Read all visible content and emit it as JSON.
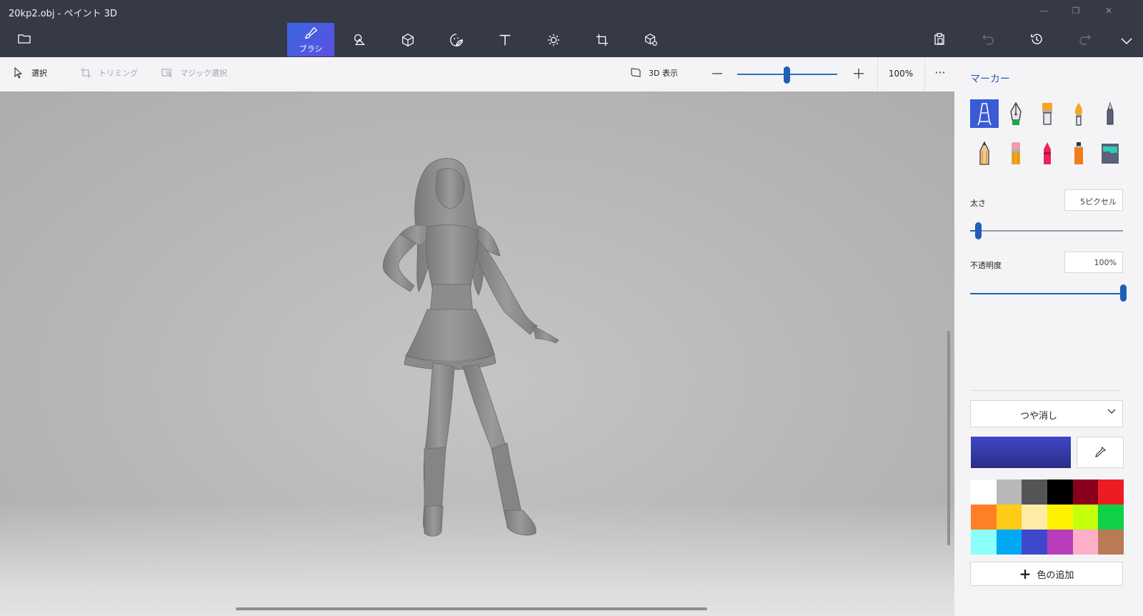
{
  "window": {
    "title": "20kp2.obj - ペイント 3D",
    "controls": [
      "minimize-icon",
      "restore-icon",
      "close-icon"
    ]
  },
  "menubar": {
    "tools": [
      {
        "id": "brushes",
        "label": "ブラシ",
        "icon": "brush-icon",
        "active": true
      },
      {
        "id": "2d-shapes",
        "label": "",
        "icon": "2d-shapes-icon"
      },
      {
        "id": "3d-shapes",
        "label": "",
        "icon": "3d-cube-icon"
      },
      {
        "id": "stickers",
        "label": "",
        "icon": "sticker-icon"
      },
      {
        "id": "text",
        "label": "",
        "icon": "text-icon"
      },
      {
        "id": "effects",
        "label": "",
        "icon": "effects-sun-icon"
      },
      {
        "id": "canvas",
        "label": "",
        "icon": "canvas-crop-icon"
      },
      {
        "id": "3d-library",
        "label": "",
        "icon": "3d-library-icon"
      }
    ],
    "right_icons": [
      "paste-icon",
      "undo-icon",
      "history-icon",
      "redo-icon",
      "chevron-down-icon"
    ]
  },
  "toolbar": {
    "select_label": "選択",
    "crop_label": "トリミング",
    "magic_select_label": "マジック選択",
    "view3d_label": "3D 表示",
    "zoom_value": "100%",
    "zoom_level": 0.5,
    "more_label": "···"
  },
  "panel": {
    "title": "マーカー",
    "brushes": [
      {
        "name": "marker",
        "selected": true
      },
      {
        "name": "calligraphy-pen"
      },
      {
        "name": "oil-brush"
      },
      {
        "name": "watercolor"
      },
      {
        "name": "pixel-pen"
      },
      {
        "name": "pencil"
      },
      {
        "name": "eraser"
      },
      {
        "name": "crayon"
      },
      {
        "name": "spray-can"
      },
      {
        "name": "fill"
      }
    ],
    "thickness_label": "太さ",
    "thickness_value": "5ピクセル",
    "thickness_level": 0.05,
    "opacity_label": "不透明度",
    "opacity_value": "100%",
    "opacity_level": 1.0,
    "finish_label": "つや消し",
    "selected_color": "#3f45c8",
    "palette": [
      "#ffffff",
      "#b8b8b8",
      "#555555",
      "#000000",
      "#88001b",
      "#ec1c24",
      "#ff7f27",
      "#ffca18",
      "#fdeca6",
      "#fff200",
      "#c4ff0e",
      "#0ed145",
      "#8cfffb",
      "#00a8f3",
      "#3f48cc",
      "#b83dba",
      "#ffaec8",
      "#b97a56"
    ],
    "add_color_label": "色の追加"
  }
}
